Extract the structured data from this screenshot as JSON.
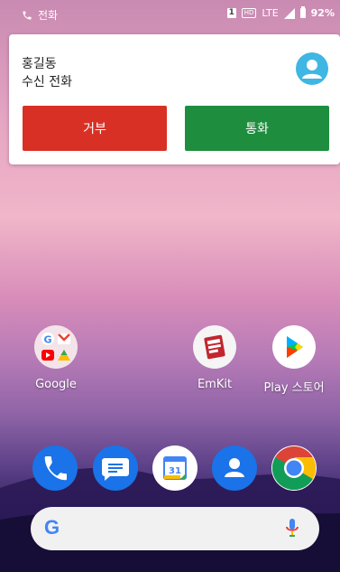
{
  "status_bar": {
    "call_label": "전화",
    "sim_label": "1",
    "hd_label": "HD",
    "network": "LTE",
    "battery": "92%"
  },
  "incoming_call": {
    "caller_name": "홍길동",
    "subtitle": "수신 전화",
    "decline_label": "거부",
    "accept_label": "통화",
    "colors": {
      "decline": "#d93025",
      "accept": "#1e8e3e",
      "avatar": "#3fb6e3"
    }
  },
  "home_apps": [
    {
      "label": "Google",
      "icon": "google-folder-icon"
    },
    {
      "label": "EmKit",
      "icon": "emkit-icon"
    },
    {
      "label": "Play 스토어",
      "icon": "play-store-icon"
    }
  ],
  "dock": [
    {
      "icon": "phone-icon"
    },
    {
      "icon": "messages-icon"
    },
    {
      "icon": "calendar-icon",
      "day": "31"
    },
    {
      "icon": "contacts-icon"
    },
    {
      "icon": "chrome-icon"
    }
  ],
  "search_bar": {
    "google_letter": "G",
    "mic": "mic-icon"
  }
}
